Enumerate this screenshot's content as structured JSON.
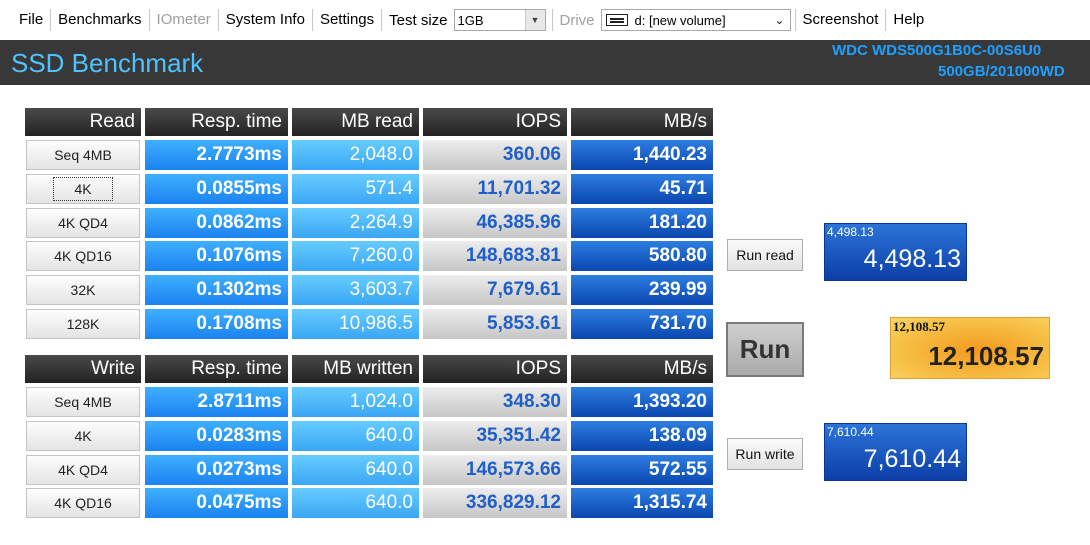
{
  "menu": {
    "file": "File",
    "benchmarks": "Benchmarks",
    "iometer": "IOmeter",
    "system_info": "System Info",
    "settings": "Settings",
    "test_size_label": "Test size",
    "test_size_value": "1GB",
    "drive_label": "Drive",
    "drive_value": "d: [new volume]",
    "screenshot": "Screenshot",
    "help": "Help"
  },
  "title": {
    "app": "SSD Benchmark",
    "drive_model": "WDC WDS500G1B0C-00S6U0",
    "drive_size": "500GB/201000WD"
  },
  "read": {
    "headers": [
      "Read",
      "Resp. time",
      "MB read",
      "IOPS",
      "MB/s"
    ],
    "rows": [
      {
        "label": "Seq 4MB",
        "resp": "2.7773ms",
        "mb": "2,048.0",
        "iops": "360.06",
        "mbs": "1,440.23"
      },
      {
        "label": "4K",
        "resp": "0.0855ms",
        "mb": "571.4",
        "iops": "11,701.32",
        "mbs": "45.71"
      },
      {
        "label": "4K QD4",
        "resp": "0.0862ms",
        "mb": "2,264.9",
        "iops": "46,385.96",
        "mbs": "181.20"
      },
      {
        "label": "4K QD16",
        "resp": "0.1076ms",
        "mb": "7,260.0",
        "iops": "148,683.81",
        "mbs": "580.80"
      },
      {
        "label": "32K",
        "resp": "0.1302ms",
        "mb": "3,603.7",
        "iops": "7,679.61",
        "mbs": "239.99"
      },
      {
        "label": "128K",
        "resp": "0.1708ms",
        "mb": "10,986.5",
        "iops": "5,853.61",
        "mbs": "731.70"
      }
    ]
  },
  "write": {
    "headers": [
      "Write",
      "Resp. time",
      "MB written",
      "IOPS",
      "MB/s"
    ],
    "rows": [
      {
        "label": "Seq 4MB",
        "resp": "2.8711ms",
        "mb": "1,024.0",
        "iops": "348.30",
        "mbs": "1,393.20"
      },
      {
        "label": "4K",
        "resp": "0.0283ms",
        "mb": "640.0",
        "iops": "35,351.42",
        "mbs": "138.09"
      },
      {
        "label": "4K QD4",
        "resp": "0.0273ms",
        "mb": "640.0",
        "iops": "146,573.66",
        "mbs": "572.55"
      },
      {
        "label": "4K QD16",
        "resp": "0.0475ms",
        "mb": "640.0",
        "iops": "336,829.12",
        "mbs": "1,315.74"
      }
    ]
  },
  "buttons": {
    "run_read": "Run read",
    "run": "Run",
    "run_write": "Run write"
  },
  "scores": {
    "read_small": "4,498.13",
    "read_big": "4,498.13",
    "total_small": "12,108.57",
    "total_big": "12,108.57",
    "write_small": "7,610.44",
    "write_big": "7,610.44"
  },
  "colors": {
    "title_text": "#4fc3ff",
    "total_score_bg": "#f39a1e",
    "score_bg": "#0c3fa8"
  }
}
